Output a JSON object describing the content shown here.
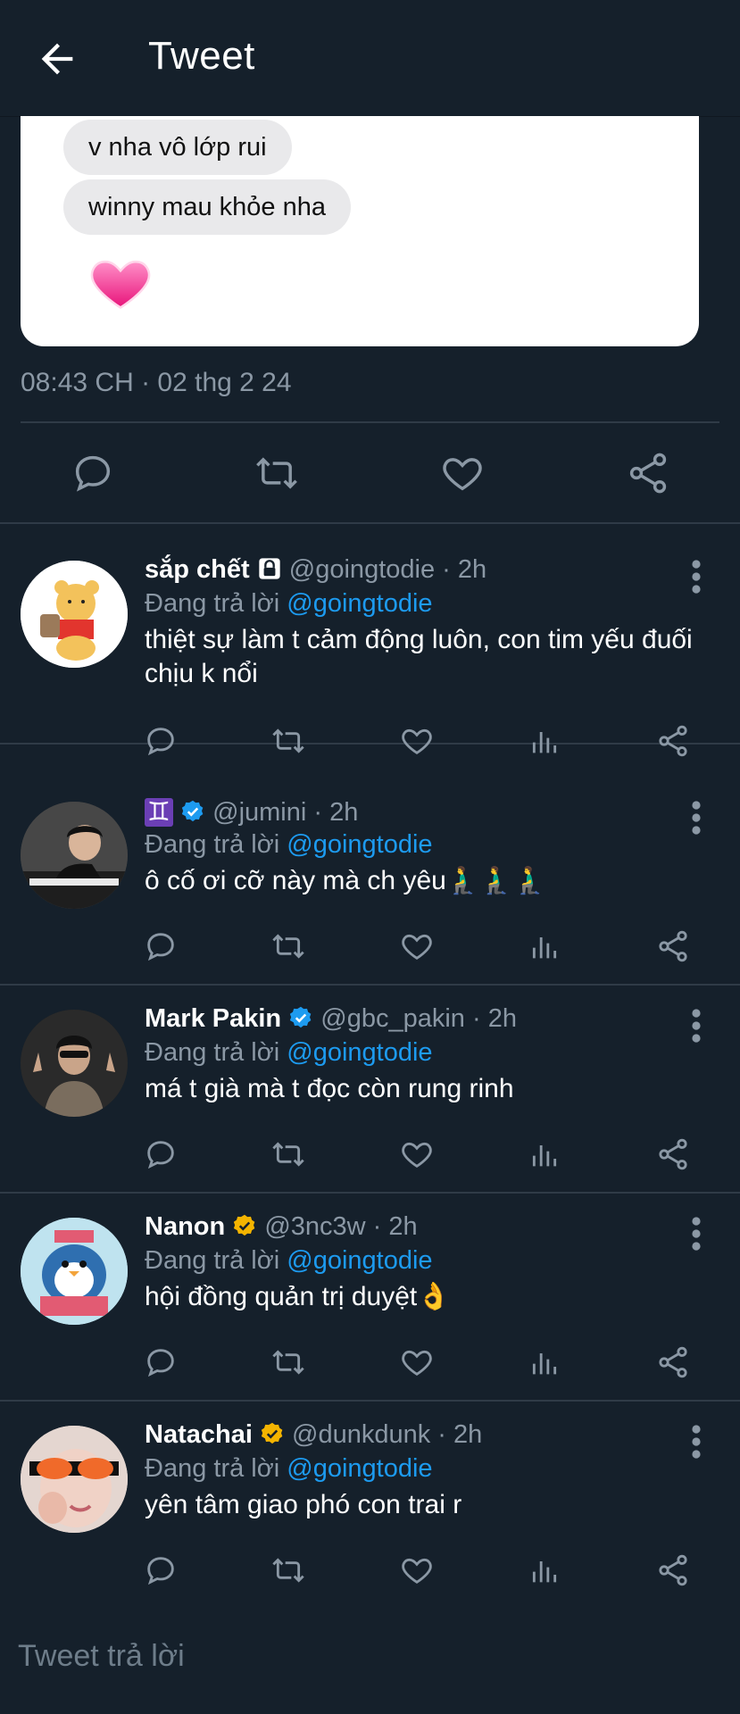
{
  "header": {
    "title": "Tweet"
  },
  "image_card": {
    "bubbles": [
      "v nha vô lớp rui",
      "winny mau khỏe nha"
    ]
  },
  "tweet": {
    "timestamp": "08:43 CH · 02 thg 2 24"
  },
  "replies": [
    {
      "name": "sắp chết",
      "handle": "@goingtodie",
      "time": "2h",
      "replying_prefix": "Đang trả lời",
      "replying_to": "@goingtodie",
      "text": "thiệt sự làm t cảm động luôn, con tim yếu đuối chịu k nổi",
      "badge": "lock-icon"
    },
    {
      "name": "♊",
      "handle": "@jumini",
      "time": "2h",
      "replying_prefix": "Đang trả lời",
      "replying_to": "@goingtodie",
      "text": "ô cố ơi cỡ này mà ch yêu🧎‍♂️🧎‍♂️🧎‍♂️",
      "badge": "verified-blue-icon"
    },
    {
      "name": "Mark Pakin",
      "handle": "@gbc_pakin",
      "time": "2h",
      "replying_prefix": "Đang trả lời",
      "replying_to": "@goingtodie",
      "text": "má t già mà t đọc còn rung rinh",
      "badge": "verified-blue-icon"
    },
    {
      "name": "Nanon",
      "handle": "@3nc3w",
      "time": "2h",
      "replying_prefix": "Đang trả lời",
      "replying_to": "@goingtodie",
      "text": "hội đồng quản trị duyệt👌",
      "badge": "verified-gold-icon"
    },
    {
      "name": "Natachai",
      "handle": "@dunkdunk",
      "time": "2h",
      "replying_prefix": "Đang trả lời",
      "replying_to": "@goingtodie",
      "text": "yên tâm giao phó con trai r",
      "badge": "verified-gold-icon"
    }
  ],
  "composer": {
    "placeholder": "Tweet trả lời"
  },
  "colors": {
    "background": "#15202b",
    "accent": "#1d9bf0",
    "muted": "#8b98a5",
    "gold": "#f4b400"
  }
}
